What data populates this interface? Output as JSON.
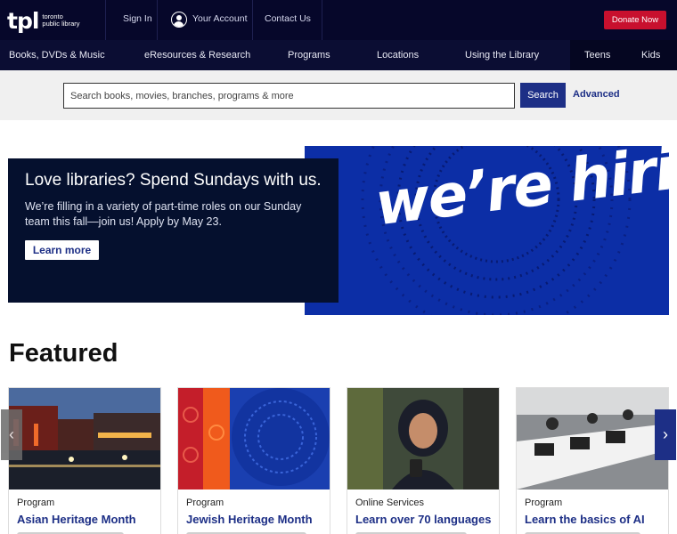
{
  "header": {
    "logo_mark": "tpl",
    "logo_text_line1": "toronto",
    "logo_text_line2": "public library",
    "sign_in": "Sign In",
    "account": "Your Account",
    "contact": "Contact Us",
    "donate": "Donate Now"
  },
  "nav": {
    "items": [
      "Books, DVDs & Music",
      "eResources & Research",
      "Programs",
      "Locations",
      "Using the Library",
      "Teens",
      "Kids"
    ]
  },
  "search": {
    "placeholder": "Search books, movies, branches, programs & more",
    "button": "Search",
    "advanced": "Advanced"
  },
  "hero": {
    "title": "Love libraries? Spend Sundays with us.",
    "body": "We’re filling in a variety of part-time roles on our Sunday team this fall—join us! Apply by May 23.",
    "button": "Learn more",
    "image_text": "we’re hiring!"
  },
  "featured": {
    "heading": "Featured",
    "cards": [
      {
        "type": "Program",
        "title": "Asian Heritage Month"
      },
      {
        "type": "Program",
        "title": "Jewish Heritage Month"
      },
      {
        "type": "Online Services",
        "title": "Learn over 70 languages"
      },
      {
        "type": "Program",
        "title": "Learn the basics of AI"
      }
    ]
  },
  "colors": {
    "header_bg": "#06072a",
    "accent_blue": "#1d2f86",
    "donate_red": "#c8102e",
    "hero_blue": "#0c2ea6"
  }
}
